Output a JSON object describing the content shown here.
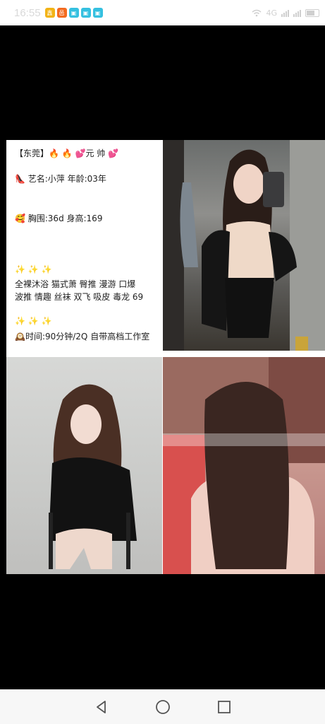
{
  "status_bar": {
    "time": "16:55",
    "apps": [
      {
        "icon": "app-icon-gold",
        "glyph": "鑫",
        "color": "#f2b316"
      },
      {
        "icon": "app-icon-orange",
        "glyph": "邑",
        "color": "#f36b20"
      },
      {
        "icon": "app-icon-cyan",
        "glyph": "▣",
        "color": "#35c0e0"
      },
      {
        "icon": "app-icon-cyan",
        "glyph": "▣",
        "color": "#35c0e0"
      },
      {
        "icon": "app-icon-cyan",
        "glyph": "▣",
        "color": "#35c0e0"
      }
    ],
    "network_label": "4G",
    "battery_label": "x"
  },
  "info": {
    "title": "【东莞】🔥 🔥  💕元  帅 💕",
    "name_line": "👠  艺名:小萍       年龄:03年",
    "bust_line": "🥰  胸围:36d       身高:169",
    "sparkles_1": "✨ ✨ ✨",
    "services_1": "全裸沐浴  猫式萧  臀推  漫游  口爆",
    "services_2": "波推  情趣  丝袜 双飞  吸皮  毒龙 69",
    "sparkles_2": "✨ ✨ ✨",
    "time_line": "🕰️时间:90分钟/2Q  自带高档工作室"
  },
  "navigation": {
    "back": "back-icon",
    "home": "home-icon",
    "recents": "recents-icon"
  }
}
